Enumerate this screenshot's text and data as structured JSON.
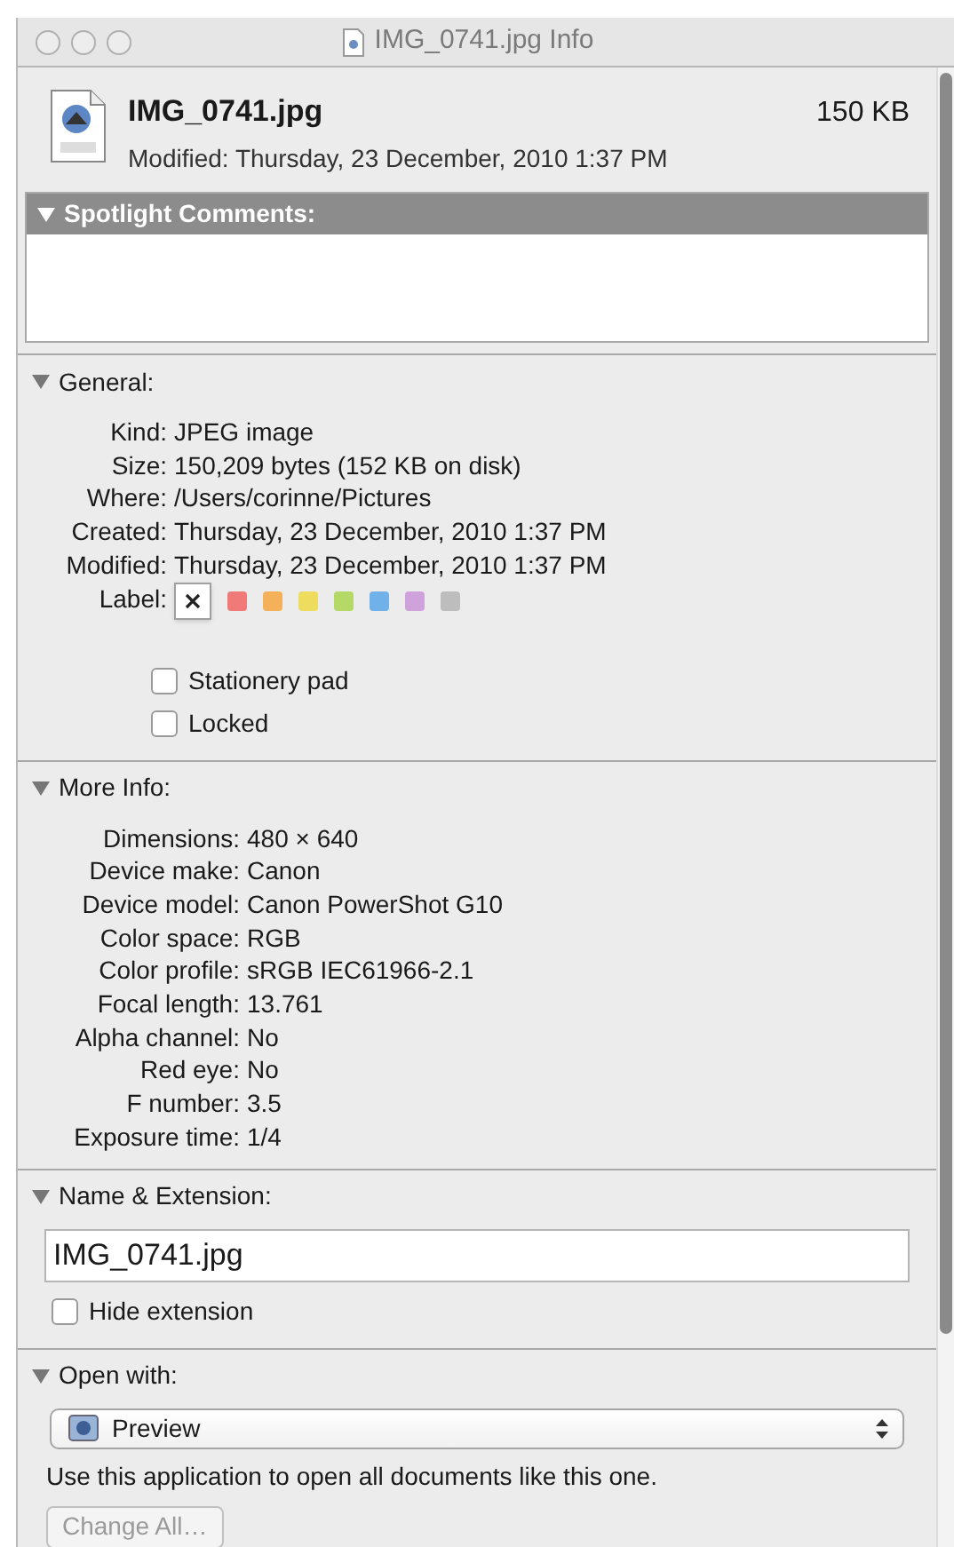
{
  "window": {
    "title": "IMG_0741.jpg Info"
  },
  "header": {
    "file_name": "IMG_0741.jpg",
    "size": "150 KB",
    "modified": "Modified: Thursday, 23 December, 2010 1:37 PM"
  },
  "sections": [
    {
      "kind": "comments",
      "title": "Spotlight Comments:",
      "expanded": true,
      "selected": true
    },
    {
      "kind": "general",
      "title": "General:",
      "expanded": true,
      "selected": false,
      "rows": [
        {
          "label": "Kind:",
          "value": "JPEG image"
        },
        {
          "label": "Size:",
          "value": "150,209 bytes (152 KB on disk)"
        },
        {
          "label": "Where:",
          "value": "/Users/corinne/Pictures"
        },
        {
          "label": "Created:",
          "value": "Thursday, 23 December, 2010 1:37 PM"
        },
        {
          "label": "Modified:",
          "value": "Thursday, 23 December, 2010 1:37 PM"
        }
      ],
      "label_field": "Label:",
      "label_options": [
        {
          "kind": "none",
          "selected": true
        },
        {
          "kind": "color",
          "color": "#f07a78",
          "selected": false
        },
        {
          "kind": "color",
          "color": "#f5b05a",
          "selected": false
        },
        {
          "kind": "color",
          "color": "#eedc5e",
          "selected": false
        },
        {
          "kind": "color",
          "color": "#b4d967",
          "selected": false
        },
        {
          "kind": "color",
          "color": "#6fb1e8",
          "selected": false
        },
        {
          "kind": "color",
          "color": "#cfa2dc",
          "selected": false
        },
        {
          "kind": "color",
          "color": "#bdbdbd",
          "selected": false
        }
      ],
      "checkboxes": [
        {
          "label": "Stationery pad",
          "checked": false
        },
        {
          "label": "Locked",
          "checked": false
        }
      ]
    },
    {
      "kind": "info",
      "title": "More Info:",
      "expanded": true,
      "selected": false,
      "rows": [
        {
          "label": "Dimensions:",
          "value": "480 × 640"
        },
        {
          "label": "Device make:",
          "value": "Canon"
        },
        {
          "label": "Device model:",
          "value": "Canon PowerShot G10"
        },
        {
          "label": "Color space:",
          "value": "RGB"
        },
        {
          "label": "Color profile:",
          "value": "sRGB IEC61966-2.1"
        },
        {
          "label": "Focal length:",
          "value": "13.761"
        },
        {
          "label": "Alpha channel:",
          "value": "No"
        },
        {
          "label": "Red eye:",
          "value": "No"
        },
        {
          "label": "F number:",
          "value": "3.5"
        },
        {
          "label": "Exposure time:",
          "value": "1/4"
        }
      ]
    },
    {
      "kind": "name",
      "title": "Name & Extension:",
      "expanded": true,
      "selected": false,
      "value": "IMG_0741.jpg",
      "checkbox": {
        "label": "Hide extension",
        "checked": false
      }
    },
    {
      "kind": "open_with",
      "title": "Open with:",
      "expanded": true,
      "selected": false,
      "app": "Preview",
      "note": "Use this application to open all documents like this one.",
      "button": {
        "label": "Change All…",
        "disabled": true
      }
    }
  ]
}
